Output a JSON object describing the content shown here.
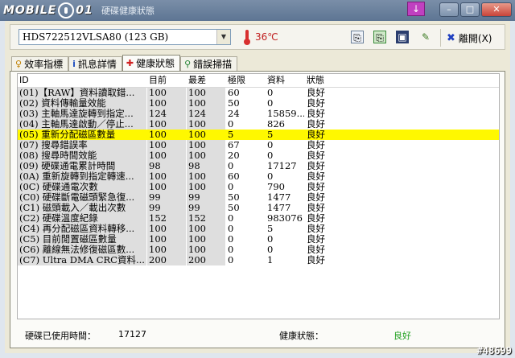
{
  "titlebar": {
    "brand": "MOBILE01",
    "title": "硬碟健康狀態",
    "download_icon": "download-arrow-icon"
  },
  "window_buttons": {
    "minimize": "–",
    "maximize": "□",
    "close": "✕"
  },
  "toolbar": {
    "drive": "HDS722512VLSA80 (123 GB)",
    "temperature": "36℃",
    "exit_label": "離開(X)"
  },
  "tabs": [
    {
      "label": "效率指標",
      "icon": "speed-icon"
    },
    {
      "label": "訊息詳情",
      "icon": "info-icon"
    },
    {
      "label": "健康狀態",
      "icon": "health-cross-icon",
      "active": true
    },
    {
      "label": "錯誤掃描",
      "icon": "magnifier-icon"
    }
  ],
  "table": {
    "headers": [
      "ID",
      "目前",
      "最差",
      "極限",
      "資料",
      "狀態"
    ],
    "rows": [
      [
        "(01)【RAW】資料讀取錯...",
        "100",
        "100",
        "60",
        "0",
        "良好"
      ],
      [
        "(02) 資料傳輸量效能",
        "100",
        "100",
        "50",
        "0",
        "良好"
      ],
      [
        "(03) 主軸馬達旋轉到指定...",
        "124",
        "124",
        "24",
        "15859...",
        "良好"
      ],
      [
        "(04) 主軸馬達啟動／停止...",
        "100",
        "100",
        "0",
        "826",
        "良好"
      ],
      [
        "(05) 重新分配磁區數量",
        "100",
        "100",
        "5",
        "5",
        "良好"
      ],
      [
        "(07) 搜尋錯誤率",
        "100",
        "100",
        "67",
        "0",
        "良好"
      ],
      [
        "(08) 搜尋時間效能",
        "100",
        "100",
        "20",
        "0",
        "良好"
      ],
      [
        "(09) 硬碟通電累計時間",
        "98",
        "98",
        "0",
        "17127",
        "良好"
      ],
      [
        "(0A) 重新旋轉到指定轉速...",
        "100",
        "100",
        "60",
        "0",
        "良好"
      ],
      [
        "(0C) 硬碟通電次數",
        "100",
        "100",
        "0",
        "790",
        "良好"
      ],
      [
        "(C0) 硬碟斷電磁頭緊急復...",
        "99",
        "99",
        "50",
        "1477",
        "良好"
      ],
      [
        "(C1) 磁頭載入／載出次數",
        "99",
        "99",
        "50",
        "1477",
        "良好"
      ],
      [
        "(C2) 硬碟溫度紀錄",
        "152",
        "152",
        "0",
        "983076",
        "良好"
      ],
      [
        "(C4) 再分配磁區資料轉移...",
        "100",
        "100",
        "0",
        "5",
        "良好"
      ],
      [
        "(C5) 目前閒置磁區數量",
        "100",
        "100",
        "0",
        "0",
        "良好"
      ],
      [
        "(C6) 離線無法修復磁區數...",
        "100",
        "100",
        "0",
        "0",
        "良好"
      ],
      [
        "(C7) Ultra DMA CRC資料...",
        "200",
        "200",
        "0",
        "1",
        "良好"
      ]
    ],
    "selected_row_index": 4
  },
  "status": {
    "hours_label": "硬碟已使用時間：",
    "hours_value": "17127",
    "health_label": "健康狀態：",
    "health_value": "良好"
  },
  "watermark": "#48699",
  "colors": {
    "selected_row": "#fff800",
    "health_good": "#20a020",
    "temperature": "#c02020"
  }
}
